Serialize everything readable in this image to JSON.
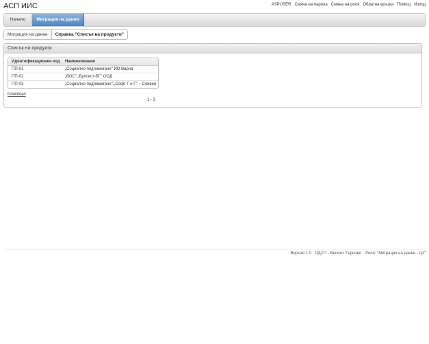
{
  "header": {
    "app_title": "АСП ИИС",
    "links": [
      "ASPUSER",
      "Смяна на парола",
      "Смяна на роля",
      "Обратна връзка",
      "Помощ",
      "Изход"
    ]
  },
  "nav": {
    "home": "Начало",
    "migration": "Миграция на данни"
  },
  "breadcrumb": {
    "parent": "Миграция на данни",
    "current": "Справка \"Списък на продукти\""
  },
  "panel": {
    "title": "Списък на продукти",
    "columns": {
      "id": "Идентификационен код",
      "name": "Наименование"
    },
    "rows": [
      {
        "id": "ПП-01",
        "name": "„Социално подпомагане\" ИО Варна"
      },
      {
        "id": "ПП-02",
        "name": "„ВОС\",„Булсист-БГ\" ООД"
      },
      {
        "id": "ПП-03",
        "name": "„Социално подпомагане\",„Софт Г и Г\" – Сливен"
      }
    ],
    "download": "Download",
    "pager": "1 - 3"
  },
  "footer": {
    "version": "Версия 1.0",
    "office": "РДСП - Велико Търново",
    "role": "Роля: \"Миграция на данни - ЦУ\""
  },
  "colors": {
    "active_tab": "#4a86c5",
    "border": "#c4c4c4"
  }
}
